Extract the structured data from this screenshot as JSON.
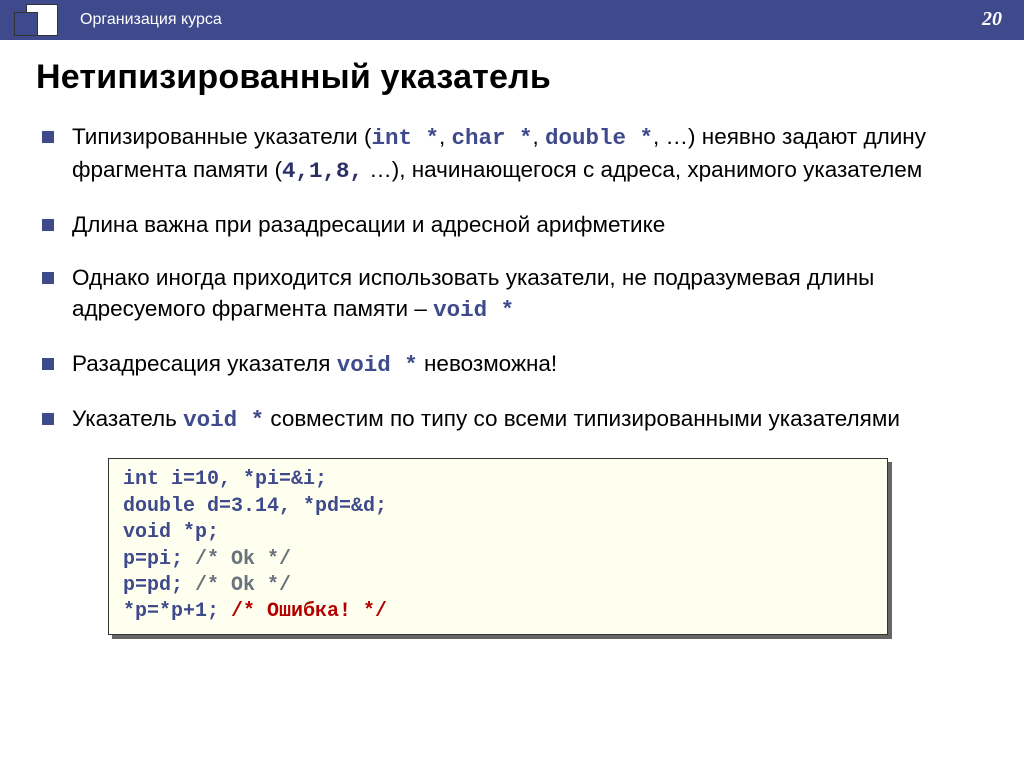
{
  "header": {
    "breadcrumb": "Организация курса",
    "pagenum": "20"
  },
  "title": "Нетипизированный указатель",
  "bullets": {
    "b1": {
      "t1": "Типизированные указатели (",
      "c1": "int *",
      "t2": ", ",
      "c2": "char *",
      "t3": ", ",
      "c3": "double *",
      "t4": ", …) неявно задают длину фрагмента памяти (",
      "c4": "4,1,8,",
      "t5": " …), начинающегося с адреса, хранимого указателем"
    },
    "b2": "Длина важна при разадресации и адресной арифметике",
    "b3": {
      "t1": "Однако иногда приходится использовать указатели, не подразумевая длины адресуемого фрагмента памяти – ",
      "c1": "void *"
    },
    "b4": {
      "t1": "Разадресация указателя ",
      "c1": "void *",
      "t2": " невозможна!"
    },
    "b5": {
      "t1": "Указатель ",
      "c1": "void *",
      "t2": " совместим по типу со всеми типизированными указателями"
    }
  },
  "code": {
    "l1a": "int",
    "l1b": " i=10, *pi=&i;",
    "l2a": "double",
    "l2b": " d=3.14, *pd=&d;",
    "l3a": "void",
    "l3b": " *p;",
    "l4a": "p=pi; ",
    "l4c": "/* Ok */",
    "l5a": "p=pd; ",
    "l5c": "/* Ok */",
    "l6a": "*p=*p+1; ",
    "l6c": "/* Ошибка! */"
  }
}
